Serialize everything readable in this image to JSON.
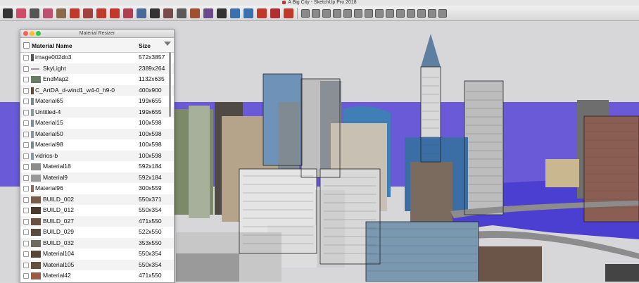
{
  "window": {
    "title": "A Big City - SketchUp Pro 2018"
  },
  "toolbar": {
    "tools": [
      "select-icon",
      "eraser-icon",
      "line-icon",
      "arc-icon",
      "shape-icon",
      "push-pull-icon",
      "offset-icon",
      "move-icon",
      "rotate-icon",
      "scale-icon",
      "tape-measure-icon",
      "text-icon",
      "axes-icon",
      "protractor-icon",
      "orbit-icon",
      "pan-icon",
      "zoom-icon",
      "zoom-extents-icon",
      "paint-bucket-icon",
      "3d-warehouse-icon",
      "extension-warehouse-icon",
      "layout-icon",
      "iso-view-icon",
      "top-view-icon",
      "front-view-icon",
      "right-view-icon",
      "back-view-icon",
      "left-view-icon",
      "xray-icon",
      "wireframe-icon",
      "hidden-line-icon",
      "shaded-icon",
      "textured-icon",
      "monochrome-icon",
      "section-icon",
      "material-resizer-icon"
    ],
    "colors": {
      "accent": "#c0392b",
      "blue": "#3a6fb0",
      "green": "#3a9a4a"
    }
  },
  "panel": {
    "title": "Material Resizer",
    "header": {
      "name": "Material Name",
      "size": "Size"
    },
    "rows": [
      {
        "name": "image002do3",
        "size": "572x3857",
        "swatch": "#555555"
      },
      {
        "name": "SkyLight",
        "size": "2389x264",
        "swatch": "#9a9a9a"
      },
      {
        "name": "EndMap2",
        "size": "1132x635",
        "swatch": "#6a7a66"
      },
      {
        "name": "C_ArtDA_d-wind1_w4-0_h9-0",
        "size": "400x900",
        "swatch": "#5d4a3a"
      },
      {
        "name": "Material65",
        "size": "199x655",
        "swatch": "#7a8a8a"
      },
      {
        "name": "Untitled-4",
        "size": "199x655",
        "swatch": "#8a9a9a"
      },
      {
        "name": "Material15",
        "size": "100x598",
        "swatch": "#7e8e96"
      },
      {
        "name": "Material50",
        "size": "100x598",
        "swatch": "#8a98a0"
      },
      {
        "name": "Material98",
        "size": "100x598",
        "swatch": "#7b8b92"
      },
      {
        "name": "vidrios-b",
        "size": "100x598",
        "swatch": "#889aa4"
      },
      {
        "name": "Material18",
        "size": "592x184",
        "swatch": "#8c8c8c"
      },
      {
        "name": "Material9",
        "size": "592x184",
        "swatch": "#999999"
      },
      {
        "name": "Material96",
        "size": "300x559",
        "swatch": "#8e6a5a"
      },
      {
        "name": "BUILD_002",
        "size": "550x371",
        "swatch": "#7a5a48"
      },
      {
        "name": "BUILD_012",
        "size": "550x354",
        "swatch": "#4a3a2e"
      },
      {
        "name": "BUILD_027",
        "size": "471x550",
        "swatch": "#6a5040"
      },
      {
        "name": "BUILD_029",
        "size": "522x550",
        "swatch": "#5e4a3c"
      },
      {
        "name": "BUILD_032",
        "size": "353x550",
        "swatch": "#6e6a62"
      },
      {
        "name": "Material104",
        "size": "550x354",
        "swatch": "#5a4636"
      },
      {
        "name": "Material105",
        "size": "550x354",
        "swatch": "#62503e"
      },
      {
        "name": "Material42",
        "size": "471x550",
        "swatch": "#9a5a44"
      }
    ]
  },
  "scene": {
    "sky": "#6a5ad8",
    "ground": "#d7d7d9",
    "water": "#4a3fd0"
  }
}
